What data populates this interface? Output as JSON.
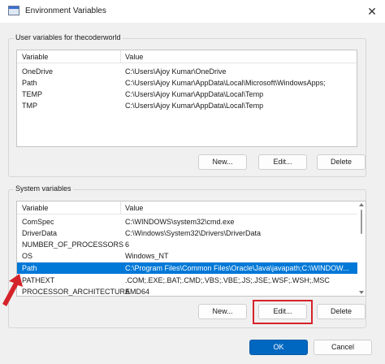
{
  "window": {
    "title": "Environment Variables"
  },
  "user_group": {
    "label": "User variables for thecoderworld",
    "columns": [
      "Variable",
      "Value"
    ],
    "rows": [
      {
        "variable": "OneDrive",
        "value": "C:\\Users\\Ajoy Kumar\\OneDrive"
      },
      {
        "variable": "Path",
        "value": "C:\\Users\\Ajoy Kumar\\AppData\\Local\\Microsoft\\WindowsApps;"
      },
      {
        "variable": "TEMP",
        "value": "C:\\Users\\Ajoy Kumar\\AppData\\Local\\Temp"
      },
      {
        "variable": "TMP",
        "value": "C:\\Users\\Ajoy Kumar\\AppData\\Local\\Temp"
      }
    ],
    "buttons": {
      "new": "New...",
      "edit": "Edit...",
      "delete": "Delete"
    }
  },
  "system_group": {
    "label": "System variables",
    "columns": [
      "Variable",
      "Value"
    ],
    "rows": [
      {
        "variable": "ComSpec",
        "value": "C:\\WINDOWS\\system32\\cmd.exe"
      },
      {
        "variable": "DriverData",
        "value": "C:\\Windows\\System32\\Drivers\\DriverData"
      },
      {
        "variable": "NUMBER_OF_PROCESSORS",
        "value": "6"
      },
      {
        "variable": "OS",
        "value": "Windows_NT"
      },
      {
        "variable": "Path",
        "value": "C:\\Program Files\\Common Files\\Oracle\\Java\\javapath;C:\\WINDOW..."
      },
      {
        "variable": "PATHEXT",
        "value": ".COM;.EXE;.BAT;.CMD;.VBS;.VBE;.JS;.JSE;.WSF;.WSH;.MSC"
      },
      {
        "variable": "PROCESSOR_ARCHITECTURE",
        "value": "AMD64"
      }
    ],
    "selected_variable": "Path",
    "buttons": {
      "new": "New...",
      "edit": "Edit...",
      "delete": "Delete"
    }
  },
  "dialog_buttons": {
    "ok": "OK",
    "cancel": "Cancel"
  },
  "colors": {
    "selection": "#0078d7",
    "primary_button": "#0067c0",
    "annotation": "#d5232a"
  },
  "icons": {
    "close": "close-icon",
    "app": "window-icon",
    "annotation_arrow": "arrow-icon"
  }
}
